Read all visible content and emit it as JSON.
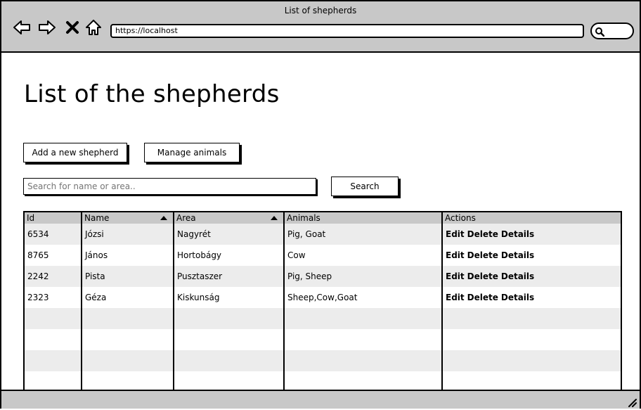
{
  "window": {
    "title": "List of shepherds"
  },
  "browser": {
    "url": "https://localhost",
    "icons": [
      "back-arrow-icon",
      "forward-arrow-icon",
      "close-x-icon",
      "home-icon",
      "search-icon"
    ]
  },
  "page": {
    "title": "List of the shepherds",
    "add_button": "Add a new shepherd",
    "manage_button": "Manage animals",
    "search_placeholder": "Search for name or area..",
    "search_button": "Search"
  },
  "table": {
    "columns": [
      "Id",
      "Name",
      "Area",
      "Animals",
      "Actions"
    ],
    "sortable": [
      false,
      true,
      true,
      false,
      false
    ],
    "rows": [
      {
        "id": "6534",
        "name": "Józsi",
        "area": "Nagyrét",
        "animals": "Pig, Goat"
      },
      {
        "id": "8765",
        "name": "János",
        "area": "Hortobágy",
        "animals": "Cow"
      },
      {
        "id": "2242",
        "name": "Pista",
        "area": "Pusztaszer",
        "animals": "Pig, Sheep"
      },
      {
        "id": "2323",
        "name": "Géza",
        "area": "Kiskunság",
        "animals": "Sheep,Cow,Goat"
      }
    ],
    "actions": {
      "edit": "Edit",
      "delete": "Delete",
      "details": "Details"
    }
  }
}
